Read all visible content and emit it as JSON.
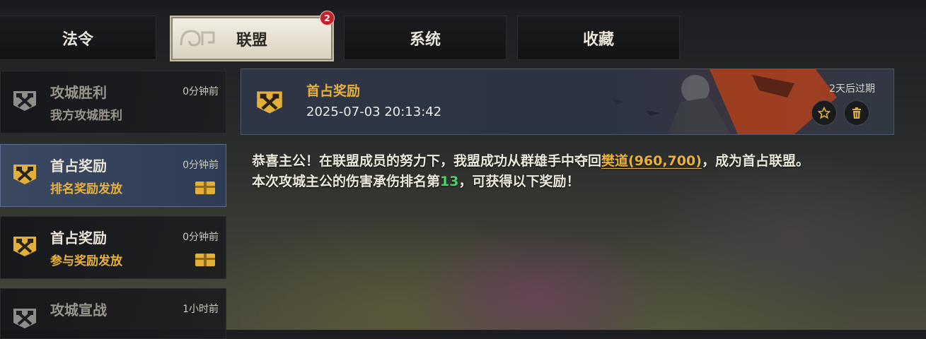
{
  "tabs": [
    {
      "label": "法令",
      "active": false
    },
    {
      "label": "联盟",
      "active": true,
      "badge": "2"
    },
    {
      "label": "系统",
      "active": false
    },
    {
      "label": "收藏",
      "active": false
    }
  ],
  "messages": [
    {
      "title": "攻城胜利",
      "subtitle": "我方攻城胜利",
      "time": "0分钟前",
      "read": true,
      "has_gift": false
    },
    {
      "title": "首占奖励",
      "subtitle": "排名奖励发放",
      "time": "0分钟前",
      "read": false,
      "has_gift": true,
      "selected": true
    },
    {
      "title": "首占奖励",
      "subtitle": "参与奖励发放",
      "time": "0分钟前",
      "read": false,
      "has_gift": true
    },
    {
      "title": "攻城宣战",
      "subtitle": "",
      "time": "1小时前",
      "read": true,
      "has_gift": false
    }
  ],
  "detail": {
    "title": "首占奖励",
    "date": "2025-07-03  20:13:42",
    "expire": "2天后过期",
    "icons": [
      "star-icon",
      "trash-icon"
    ],
    "line1_a": "恭喜主公！在联盟成员的努力下，我盟成功从群雄手中夺回",
    "location": "樊道(960,700)",
    "line1_b": "，成为首占联盟。",
    "line2_a": "本次攻城主公的伤害承伤排名第",
    "rank": "13",
    "line2_b": "，可获得以下奖励！"
  },
  "colors": {
    "accent_gold": "#e6b23c",
    "rank_green": "#49d26b",
    "badge_red": "#c4222a",
    "active_card": "#3a4862"
  }
}
